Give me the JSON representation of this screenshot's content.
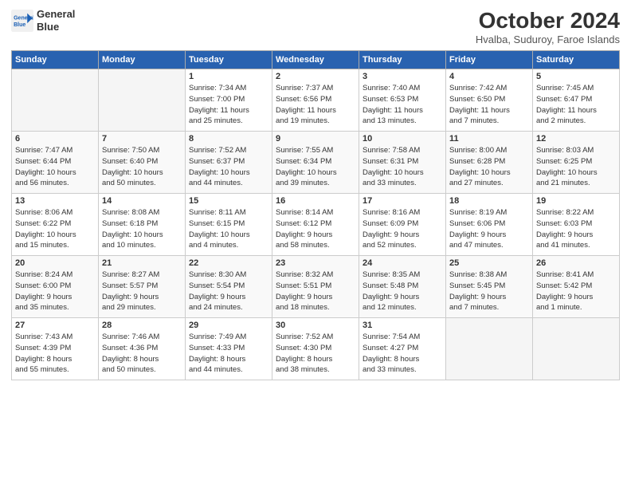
{
  "header": {
    "logo_line1": "General",
    "logo_line2": "Blue",
    "month": "October 2024",
    "location": "Hvalba, Suduroy, Faroe Islands"
  },
  "days_of_week": [
    "Sunday",
    "Monday",
    "Tuesday",
    "Wednesday",
    "Thursday",
    "Friday",
    "Saturday"
  ],
  "weeks": [
    [
      {
        "num": "",
        "info": ""
      },
      {
        "num": "",
        "info": ""
      },
      {
        "num": "1",
        "info": "Sunrise: 7:34 AM\nSunset: 7:00 PM\nDaylight: 11 hours\nand 25 minutes."
      },
      {
        "num": "2",
        "info": "Sunrise: 7:37 AM\nSunset: 6:56 PM\nDaylight: 11 hours\nand 19 minutes."
      },
      {
        "num": "3",
        "info": "Sunrise: 7:40 AM\nSunset: 6:53 PM\nDaylight: 11 hours\nand 13 minutes."
      },
      {
        "num": "4",
        "info": "Sunrise: 7:42 AM\nSunset: 6:50 PM\nDaylight: 11 hours\nand 7 minutes."
      },
      {
        "num": "5",
        "info": "Sunrise: 7:45 AM\nSunset: 6:47 PM\nDaylight: 11 hours\nand 2 minutes."
      }
    ],
    [
      {
        "num": "6",
        "info": "Sunrise: 7:47 AM\nSunset: 6:44 PM\nDaylight: 10 hours\nand 56 minutes."
      },
      {
        "num": "7",
        "info": "Sunrise: 7:50 AM\nSunset: 6:40 PM\nDaylight: 10 hours\nand 50 minutes."
      },
      {
        "num": "8",
        "info": "Sunrise: 7:52 AM\nSunset: 6:37 PM\nDaylight: 10 hours\nand 44 minutes."
      },
      {
        "num": "9",
        "info": "Sunrise: 7:55 AM\nSunset: 6:34 PM\nDaylight: 10 hours\nand 39 minutes."
      },
      {
        "num": "10",
        "info": "Sunrise: 7:58 AM\nSunset: 6:31 PM\nDaylight: 10 hours\nand 33 minutes."
      },
      {
        "num": "11",
        "info": "Sunrise: 8:00 AM\nSunset: 6:28 PM\nDaylight: 10 hours\nand 27 minutes."
      },
      {
        "num": "12",
        "info": "Sunrise: 8:03 AM\nSunset: 6:25 PM\nDaylight: 10 hours\nand 21 minutes."
      }
    ],
    [
      {
        "num": "13",
        "info": "Sunrise: 8:06 AM\nSunset: 6:22 PM\nDaylight: 10 hours\nand 15 minutes."
      },
      {
        "num": "14",
        "info": "Sunrise: 8:08 AM\nSunset: 6:18 PM\nDaylight: 10 hours\nand 10 minutes."
      },
      {
        "num": "15",
        "info": "Sunrise: 8:11 AM\nSunset: 6:15 PM\nDaylight: 10 hours\nand 4 minutes."
      },
      {
        "num": "16",
        "info": "Sunrise: 8:14 AM\nSunset: 6:12 PM\nDaylight: 9 hours\nand 58 minutes."
      },
      {
        "num": "17",
        "info": "Sunrise: 8:16 AM\nSunset: 6:09 PM\nDaylight: 9 hours\nand 52 minutes."
      },
      {
        "num": "18",
        "info": "Sunrise: 8:19 AM\nSunset: 6:06 PM\nDaylight: 9 hours\nand 47 minutes."
      },
      {
        "num": "19",
        "info": "Sunrise: 8:22 AM\nSunset: 6:03 PM\nDaylight: 9 hours\nand 41 minutes."
      }
    ],
    [
      {
        "num": "20",
        "info": "Sunrise: 8:24 AM\nSunset: 6:00 PM\nDaylight: 9 hours\nand 35 minutes."
      },
      {
        "num": "21",
        "info": "Sunrise: 8:27 AM\nSunset: 5:57 PM\nDaylight: 9 hours\nand 29 minutes."
      },
      {
        "num": "22",
        "info": "Sunrise: 8:30 AM\nSunset: 5:54 PM\nDaylight: 9 hours\nand 24 minutes."
      },
      {
        "num": "23",
        "info": "Sunrise: 8:32 AM\nSunset: 5:51 PM\nDaylight: 9 hours\nand 18 minutes."
      },
      {
        "num": "24",
        "info": "Sunrise: 8:35 AM\nSunset: 5:48 PM\nDaylight: 9 hours\nand 12 minutes."
      },
      {
        "num": "25",
        "info": "Sunrise: 8:38 AM\nSunset: 5:45 PM\nDaylight: 9 hours\nand 7 minutes."
      },
      {
        "num": "26",
        "info": "Sunrise: 8:41 AM\nSunset: 5:42 PM\nDaylight: 9 hours\nand 1 minute."
      }
    ],
    [
      {
        "num": "27",
        "info": "Sunrise: 7:43 AM\nSunset: 4:39 PM\nDaylight: 8 hours\nand 55 minutes."
      },
      {
        "num": "28",
        "info": "Sunrise: 7:46 AM\nSunset: 4:36 PM\nDaylight: 8 hours\nand 50 minutes."
      },
      {
        "num": "29",
        "info": "Sunrise: 7:49 AM\nSunset: 4:33 PM\nDaylight: 8 hours\nand 44 minutes."
      },
      {
        "num": "30",
        "info": "Sunrise: 7:52 AM\nSunset: 4:30 PM\nDaylight: 8 hours\nand 38 minutes."
      },
      {
        "num": "31",
        "info": "Sunrise: 7:54 AM\nSunset: 4:27 PM\nDaylight: 8 hours\nand 33 minutes."
      },
      {
        "num": "",
        "info": ""
      },
      {
        "num": "",
        "info": ""
      }
    ]
  ]
}
